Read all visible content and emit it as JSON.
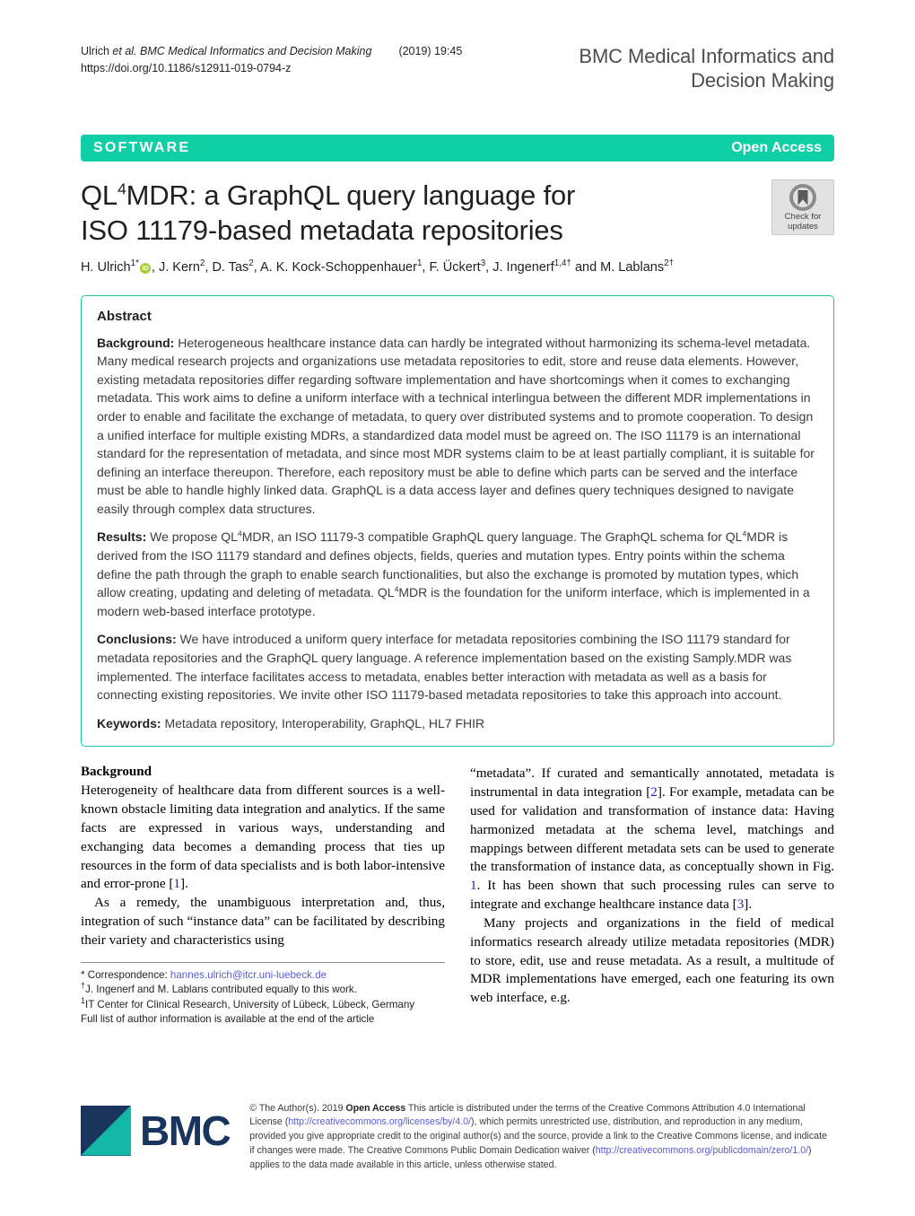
{
  "running_head": {
    "citation_prefix": "Ulrich ",
    "et_al": "et al.",
    "journal": " BMC Medical Informatics and Decision Making",
    "volume": "(2019) 19:45",
    "doi": "https://doi.org/10.1186/s12911-019-0794-z",
    "journal_title_line1": "BMC Medical Informatics and",
    "journal_title_line2": "Decision Making"
  },
  "banner": {
    "article_type": "SOFTWARE",
    "access_label": "Open Access",
    "color": "#0fcfa7"
  },
  "title": {
    "line1_pre": "QL",
    "line1_sup": "4",
    "line1_post": "MDR: a GraphQL query language for",
    "line2": "ISO 11179-based metadata repositories"
  },
  "crossmark": {
    "line1": "Check for",
    "line2": "updates"
  },
  "authors": {
    "full_line": "H. Ulrich1*, J. Kern2, D. Tas2, A. K. Kock-Schoppenhauer1, F. Ückert3, J. Ingenerf1,4† and M. Lablans2†",
    "orcid_label": "iD",
    "parts": [
      {
        "name": "H. Ulrich",
        "sup": "1*",
        "orcid": true
      },
      {
        "name": ", J. Kern",
        "sup": "2"
      },
      {
        "name": ", D. Tas",
        "sup": "2"
      },
      {
        "name": ", A. K. Kock-Schoppenhauer",
        "sup": "1"
      },
      {
        "name": ", F. Ückert",
        "sup": "3"
      },
      {
        "name": ", J. Ingenerf",
        "sup": "1,4†"
      },
      {
        "name": " and M. Lablans",
        "sup": "2†"
      }
    ]
  },
  "abstract": {
    "heading": "Abstract",
    "background_label": "Background:",
    "background_text": " Heterogeneous healthcare instance data can hardly be integrated without harmonizing its schema-level metadata. Many medical research projects and organizations use metadata repositories to edit, store and reuse data elements. However, existing metadata repositories differ regarding software implementation and have shortcomings when it comes to exchanging metadata. This work aims to define a uniform interface with a technical interlingua between the different MDR implementations in order to enable and facilitate the exchange of metadata, to query over distributed systems and to promote cooperation. To design a unified interface for multiple existing MDRs, a standardized data model must be agreed on. The ISO 11179 is an international standard for the representation of metadata, and since most MDR systems claim to be at least partially compliant, it is suitable for defining an interface thereupon. Therefore, each repository must be able to define which parts can be served and the interface must be able to handle highly linked data. GraphQL is a data access layer and defines query techniques designed to navigate easily through complex data structures.",
    "results_label": "Results:",
    "results_seg1": " We propose QL",
    "results_seg2": "MDR, an ISO 11179-3 compatible GraphQL query language. The GraphQL schema for QL",
    "results_seg3": "MDR is derived from the ISO 11179 standard and defines objects, fields, queries and mutation types. Entry points within the schema define the path through the graph to enable search functionalities, but also the exchange is promoted by mutation types, which allow creating, updating and deleting of metadata. QL",
    "results_seg4": "MDR is the foundation for the uniform interface, which is implemented in a modern web-based interface prototype.",
    "sup4": "4",
    "conclusions_label": "Conclusions:",
    "conclusions_text": " We have introduced a uniform query interface for metadata repositories combining the ISO 11179 standard for metadata repositories and the GraphQL query language. A reference implementation based on the existing Samply.MDR was implemented. The interface facilitates access to metadata, enables better interaction with metadata as well as a basis for connecting existing repositories. We invite other ISO 11179-based metadata repositories to take this approach into account.",
    "keywords_label": "Keywords:",
    "keywords_text": " Metadata repository, Interoperability, GraphQL, HL7 FHIR"
  },
  "body": {
    "section_heading": "Background",
    "left_p1_a": "Heterogeneity of healthcare data from different sources is a well-known obstacle limiting data integration and analytics. If the same facts are expressed in various ways, understanding and exchanging data becomes a demanding process that ties up resources in the form of data specialists and is both labor-intensive and error-prone [",
    "left_p1_ref": "1",
    "left_p1_b": "].",
    "left_p2": "As a remedy, the unambiguous interpretation and, thus, integration of such “instance data” can be facilitated by describing their variety and characteristics using",
    "right_p1_a": "“metadata”. If curated and semantically annotated, metadata is instrumental in data integration [",
    "right_p1_ref1": "2",
    "right_p1_b": "]. For example, metadata can be used for validation and transformation of instance data: Having harmonized metadata at the schema level, matchings and mappings between different metadata sets can be used to generate the transformation of instance data, as conceptually shown in Fig. ",
    "right_p1_ref2": "1",
    "right_p1_c": ". It has been shown that such processing rules can serve to integrate and exchange healthcare instance data [",
    "right_p1_ref3": "3",
    "right_p1_d": "].",
    "right_p2": "Many projects and organizations in the field of medical informatics research already utilize metadata repositories (MDR) to store, edit, use and reuse metadata. As a result, a multitude of MDR implementations have emerged, each one featuring its own web interface, e.g."
  },
  "footnote": {
    "correspondence_label": "* Correspondence: ",
    "correspondence_email": "hannes.ulrich@itcr.uni-luebeck.de",
    "equal_contrib_sup": "†",
    "equal_contrib": "J. Ingenerf and M. Lablans contributed equally to this work.",
    "affiliation_sup": "1",
    "affiliation": "IT Center for Clinical Research, University of Lübeck, Lübeck, Germany",
    "full_list": "Full list of author information is available at the end of the article"
  },
  "footer": {
    "logo_text": "BMC",
    "copyright_a": "© The Author(s). 2019 ",
    "copyright_open_access": "Open Access",
    "copyright_b": " This article is distributed under the terms of the Creative Commons Attribution 4.0 International License (",
    "license_url": "http://creativecommons.org/licenses/by/4.0/",
    "copyright_c": "), which permits unrestricted use, distribution, and reproduction in any medium, provided you give appropriate credit to the original author(s) and the source, provide a link to the Creative Commons license, and indicate if changes were made. The Creative Commons Public Domain Dedication waiver (",
    "waiver_url": "http://creativecommons.org/publicdomain/zero/1.0/",
    "copyright_d": ") applies to the data made available in this article, unless otherwise stated."
  }
}
